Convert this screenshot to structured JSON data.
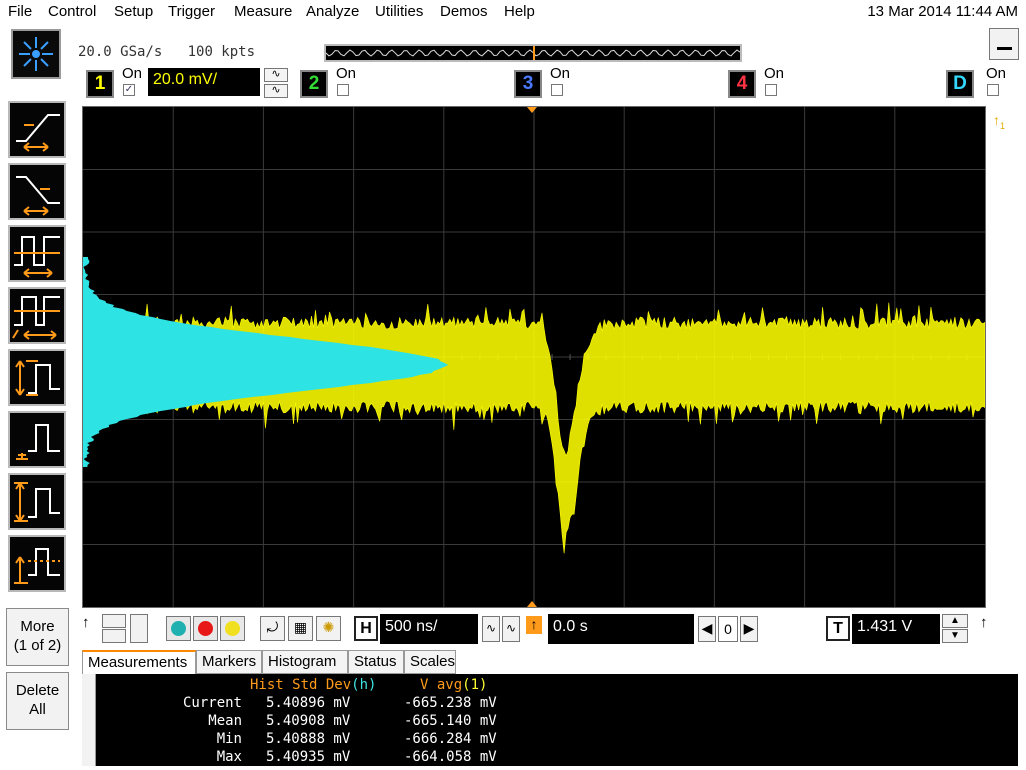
{
  "menu": {
    "items": [
      "File",
      "Control",
      "Setup",
      "Trigger",
      "Measure",
      "Analyze",
      "Utilities",
      "Demos",
      "Help"
    ],
    "datetime": "13 Mar 2014 11:44 AM"
  },
  "acquisition": {
    "sample_rate": "20.0 GSa/s",
    "memory_depth": "100 kpts"
  },
  "channels": {
    "ch1": {
      "label": "1",
      "on_label": "On",
      "checked": true,
      "scale": "20.0 mV/",
      "color": "#ffff00"
    },
    "ch2": {
      "label": "2",
      "on_label": "On",
      "checked": false,
      "color": "#33dd33"
    },
    "ch3": {
      "label": "3",
      "on_label": "On",
      "checked": false,
      "color": "#4a7bff"
    },
    "ch4": {
      "label": "4",
      "on_label": "On",
      "checked": false,
      "color": "#ff3344"
    },
    "digital": {
      "label": "D",
      "on_label": "On",
      "checked": false,
      "color": "#33d8ff"
    }
  },
  "sidebar": {
    "more_label": "More\n(1 of 2)",
    "more_line1": "More",
    "more_line2": "(1 of 2)",
    "delete_line1": "Delete",
    "delete_line2": "All",
    "trigger_icons": [
      "rising-edge-trigger-icon",
      "falling-edge-trigger-icon",
      "pulse-width-trigger-icon",
      "pulse-width-ratio-trigger-icon",
      "rise-time-trigger-icon",
      "glitch-trigger-icon",
      "amplitude-trigger-icon",
      "threshold-trigger-icon"
    ]
  },
  "controls": {
    "timebase": "500 ns/",
    "delay": "0.0 s",
    "position": "0",
    "trigger_letter": "T",
    "trigger_level": "1.431 V",
    "horizontal_letter": "H",
    "color_buttons": [
      "#20b0b0",
      "#e81818",
      "#f0e020"
    ]
  },
  "tabs": [
    "Measurements",
    "Markers",
    "Histogram",
    "Status",
    "Scales"
  ],
  "active_tab": "Measurements",
  "measurements": {
    "col1_header": "Hist Std Dev",
    "col1_source": "(h)",
    "col2_header": "V avg",
    "col2_source": "(1)",
    "rows": [
      {
        "label": "Current",
        "v1": "5.40896 mV",
        "v2": "-665.238 mV"
      },
      {
        "label": "Mean",
        "v1": "5.40908 mV",
        "v2": "-665.140 mV"
      },
      {
        "label": "Min",
        "v1": "5.40888 mV",
        "v2": "-666.284 mV"
      },
      {
        "label": "Max",
        "v1": "5.40935 mV",
        "v2": "-664.058 mV"
      }
    ]
  },
  "colors": {
    "trace": "#ffff00",
    "histogram": "#2ee3e3",
    "grid": "#3a3a3a",
    "accent": "#ff9a1a"
  }
}
